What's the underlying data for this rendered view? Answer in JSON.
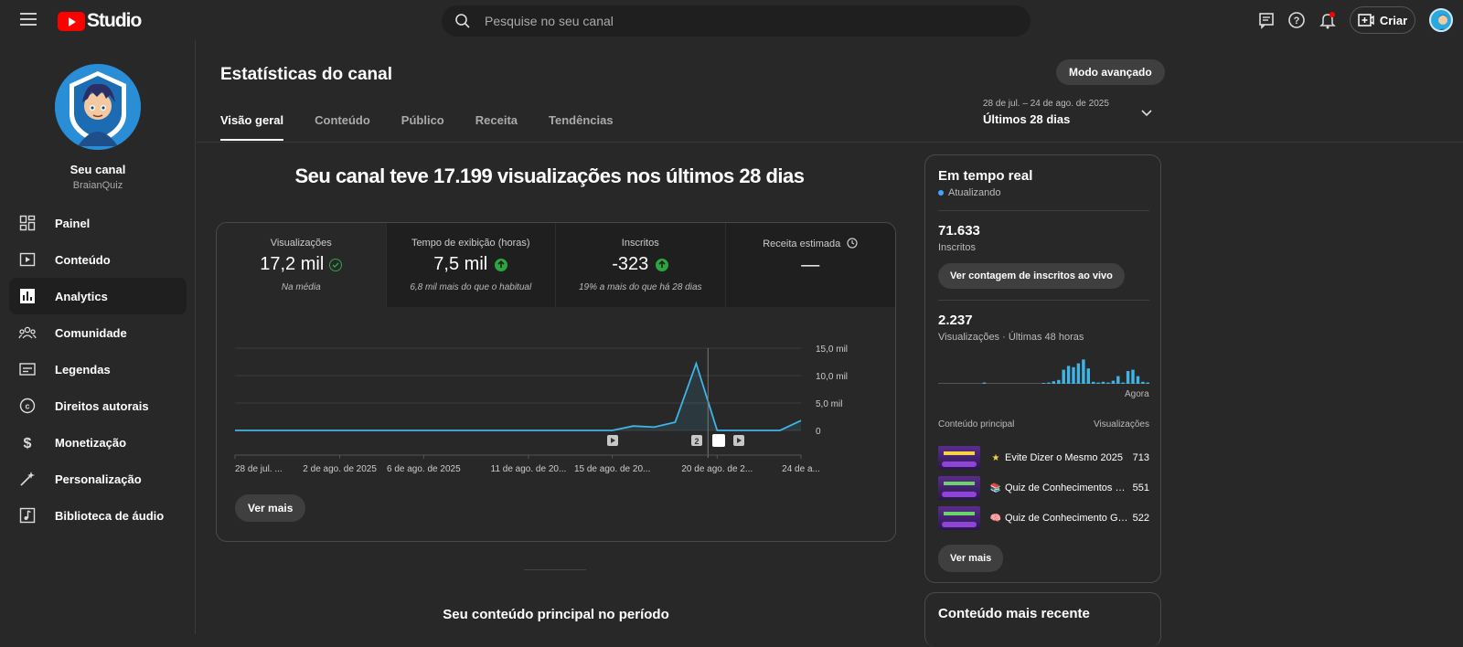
{
  "app": {
    "logo_text": "Studio",
    "brand_color": "#ff0000"
  },
  "search": {
    "placeholder": "Pesquise no seu canal"
  },
  "topbar": {
    "create_label": "Criar"
  },
  "channel": {
    "name": "Seu canal",
    "handle": "BraianQuiz"
  },
  "sidebar": {
    "items": [
      {
        "label": "Painel",
        "icon": "dashboard-icon"
      },
      {
        "label": "Conteúdo",
        "icon": "content-icon"
      },
      {
        "label": "Analytics",
        "icon": "analytics-icon",
        "active": true
      },
      {
        "label": "Comunidade",
        "icon": "community-icon"
      },
      {
        "label": "Legendas",
        "icon": "subtitles-icon"
      },
      {
        "label": "Direitos autorais",
        "icon": "copyright-icon"
      },
      {
        "label": "Monetização",
        "icon": "dollar-icon"
      },
      {
        "label": "Personalização",
        "icon": "magic-wand-icon"
      },
      {
        "label": "Biblioteca de áudio",
        "icon": "audio-library-icon"
      }
    ]
  },
  "page": {
    "title": "Estatísticas do canal",
    "advanced_mode": "Modo avançado",
    "tabs": [
      "Visão geral",
      "Conteúdo",
      "Público",
      "Receita",
      "Tendências"
    ],
    "date_range": {
      "dates": "28 de jul. – 24 de ago. de 2025",
      "label": "Últimos 28 dias"
    },
    "headline": "Seu canal teve 17.199 visualizações nos últimos 28 dias",
    "see_more": "Ver mais",
    "top_content_title": "Seu conteúdo principal no período"
  },
  "metrics": [
    {
      "label": "Visualizações",
      "value": "17,2 mil",
      "note": "Na média"
    },
    {
      "label": "Tempo de exibição (horas)",
      "value": "7,5 mil",
      "note": "6,8 mil mais do que o habitual"
    },
    {
      "label": "Inscritos",
      "value": "-323",
      "note": "19% a mais do que há 28 dias"
    },
    {
      "label": "Receita estimada",
      "value": "—",
      "note": ""
    }
  ],
  "chart_data": {
    "type": "line",
    "x": [
      "28 de jul.",
      "29 de jul.",
      "30 de jul.",
      "31 de jul.",
      "1 de ago.",
      "2 de ago.",
      "3 de ago.",
      "4 de ago.",
      "5 de ago.",
      "6 de ago.",
      "7 de ago.",
      "8 de ago.",
      "9 de ago.",
      "10 de ago.",
      "11 de ago.",
      "12 de ago.",
      "13 de ago.",
      "14 de ago.",
      "15 de ago.",
      "16 de ago.",
      "17 de ago.",
      "18 de ago.",
      "19 de ago.",
      "20 de ago.",
      "21 de ago.",
      "22 de ago.",
      "23 de ago.",
      "24 de ago."
    ],
    "series": [
      {
        "values": [
          0,
          0,
          0,
          0,
          0,
          0,
          0,
          0,
          0,
          0,
          0,
          0,
          0,
          0,
          0,
          0,
          0,
          0,
          0,
          800,
          600,
          1500,
          12200,
          0,
          0,
          0,
          0,
          1800
        ]
      }
    ],
    "tick_labels": [
      "28 de jul. ...",
      "2 de ago. de 2025",
      "6 de ago. de 2025",
      "11 de ago. de 20...",
      "15 de ago. de 20...",
      "20 de ago. de 2...",
      "24 de a..."
    ],
    "tick_indices": [
      0,
      5,
      9,
      14,
      18,
      23,
      27
    ],
    "y_ticks": [
      "15,0 mil",
      "10,0 mil",
      "5,0 mil",
      "0"
    ],
    "y_tick_values": [
      15000,
      10000,
      5000,
      0
    ],
    "ylim": [
      0,
      15000
    ],
    "marker_index": 23,
    "annotation_badge": "2",
    "line_color": "#41b4e6"
  },
  "realtime": {
    "title": "Em tempo real",
    "status": "Atualizando",
    "subscribers_value": "71.633",
    "subscribers_label": "Inscritos",
    "live_count_button": "Ver contagem de inscritos ao vivo",
    "views_value": "2.237",
    "views_label": "Visualizações · Últimas 48 horas",
    "now_label": "Agora",
    "bars": [
      0,
      0,
      0,
      0,
      0,
      0,
      0,
      0,
      0,
      0.05,
      0,
      0,
      0,
      0,
      0,
      0,
      0,
      0,
      0,
      0,
      0,
      0.03,
      0.05,
      0.1,
      0.15,
      0.55,
      0.7,
      0.65,
      0.8,
      0.95,
      0.6,
      0.08,
      0.05,
      0.08,
      0.05,
      0.12,
      0.3,
      0.05,
      0.5,
      0.55,
      0.3,
      0.08,
      0.05
    ],
    "top_content_label": "Conteúdo principal",
    "views_col_label": "Visualizações",
    "videos": [
      {
        "emoji": "★",
        "title": "Evite Dizer o Mesmo 2025",
        "views": "713"
      },
      {
        "emoji": "📚",
        "title": "Quiz de Conhecimentos Gerais",
        "views": "551"
      },
      {
        "emoji": "🧠",
        "title": "Quiz de Conhecimento Geral",
        "views": "522"
      }
    ],
    "see_more": "Ver mais"
  },
  "recent": {
    "title": "Conteúdo mais recente"
  }
}
